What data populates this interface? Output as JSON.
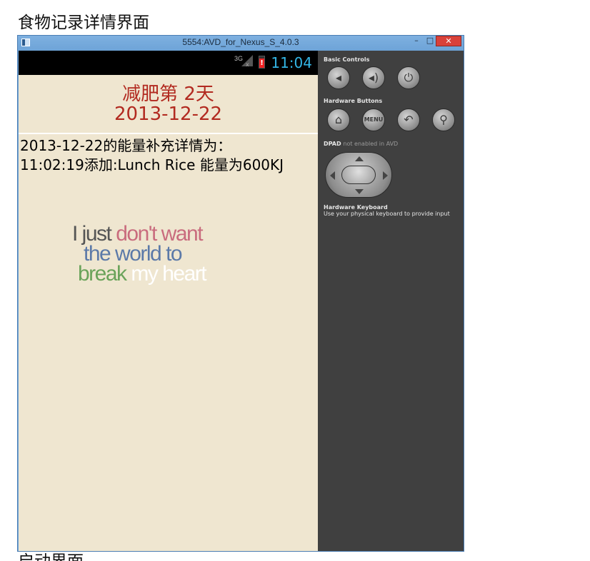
{
  "document": {
    "heading": "食物记录详情界面",
    "next_heading": "启动界面"
  },
  "window": {
    "title": "5554:AVD_for_Nexus_S_4.0.3",
    "minimize_label": "–",
    "maximize_label": "□",
    "close_label": "✕"
  },
  "statusbar": {
    "network": "3G",
    "no_signal": "x",
    "battery_alert": "!",
    "time": "11:04"
  },
  "app": {
    "header_line1": "减肥第 2天",
    "header_line2": "2013-12-22",
    "detail_line1": "2013-12-22的能量补充详情为：",
    "detail_line2": "11:02:19添加:Lunch Rice 能量为600KJ",
    "quote": {
      "w1": "I just",
      "w2": "don't want",
      "w3": "the world to",
      "w4": "break",
      "w5": "my heart"
    }
  },
  "controls": {
    "basic_title": "Basic Controls",
    "hardware_title": "Hardware Buttons",
    "dpad_title": "DPAD",
    "dpad_note": "not enabled in AVD",
    "keyboard_title": "Hardware Keyboard",
    "keyboard_desc": "Use your physical keyboard to provide input",
    "menu_label": "MENU",
    "icons": [
      "volume-down-icon",
      "volume-up-icon",
      "power-icon",
      "home-icon",
      "menu-icon",
      "back-icon",
      "search-icon"
    ]
  },
  "colors": {
    "header_red": "#b22a20",
    "clock_blue": "#33b5e5",
    "app_background": "#efe6d0",
    "panel_background": "#404040"
  }
}
